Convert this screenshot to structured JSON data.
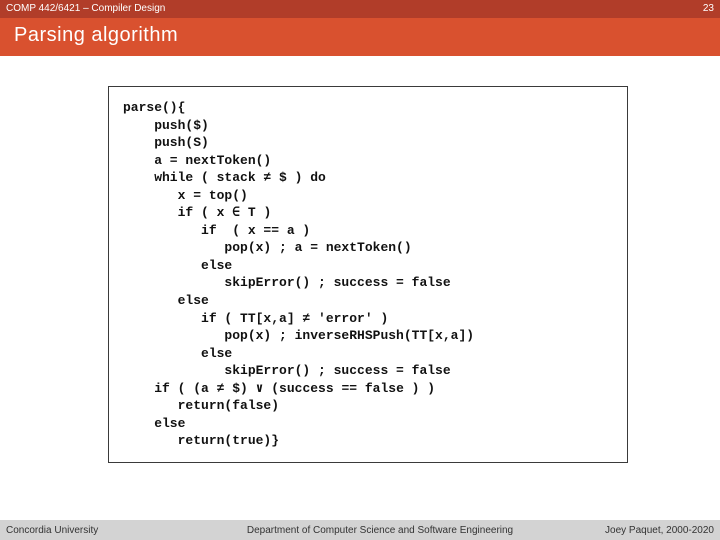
{
  "header": {
    "course": "COMP 442/6421 – Compiler Design",
    "page_number": "23",
    "title": "Parsing algorithm"
  },
  "code": "parse(){\n    push($)\n    push(S)\n    a = nextToken()\n    while ( stack ≠ $ ) do\n       x = top()\n       if ( x ∈ T )\n          if  ( x == a )\n             pop(x) ; a = nextToken()\n          else\n             skipError() ; success = false\n       else\n          if ( TT[x,a] ≠ 'error' )\n             pop(x) ; inverseRHSPush(TT[x,a])\n          else\n             skipError() ; success = false\n    if ( (a ≠ $) ∨ (success == false ) )\n       return(false)\n    else\n       return(true)}",
  "footer": {
    "left": "Concordia University",
    "center": "Department of Computer Science and Software Engineering",
    "right": "Joey Paquet, 2000-2020"
  }
}
